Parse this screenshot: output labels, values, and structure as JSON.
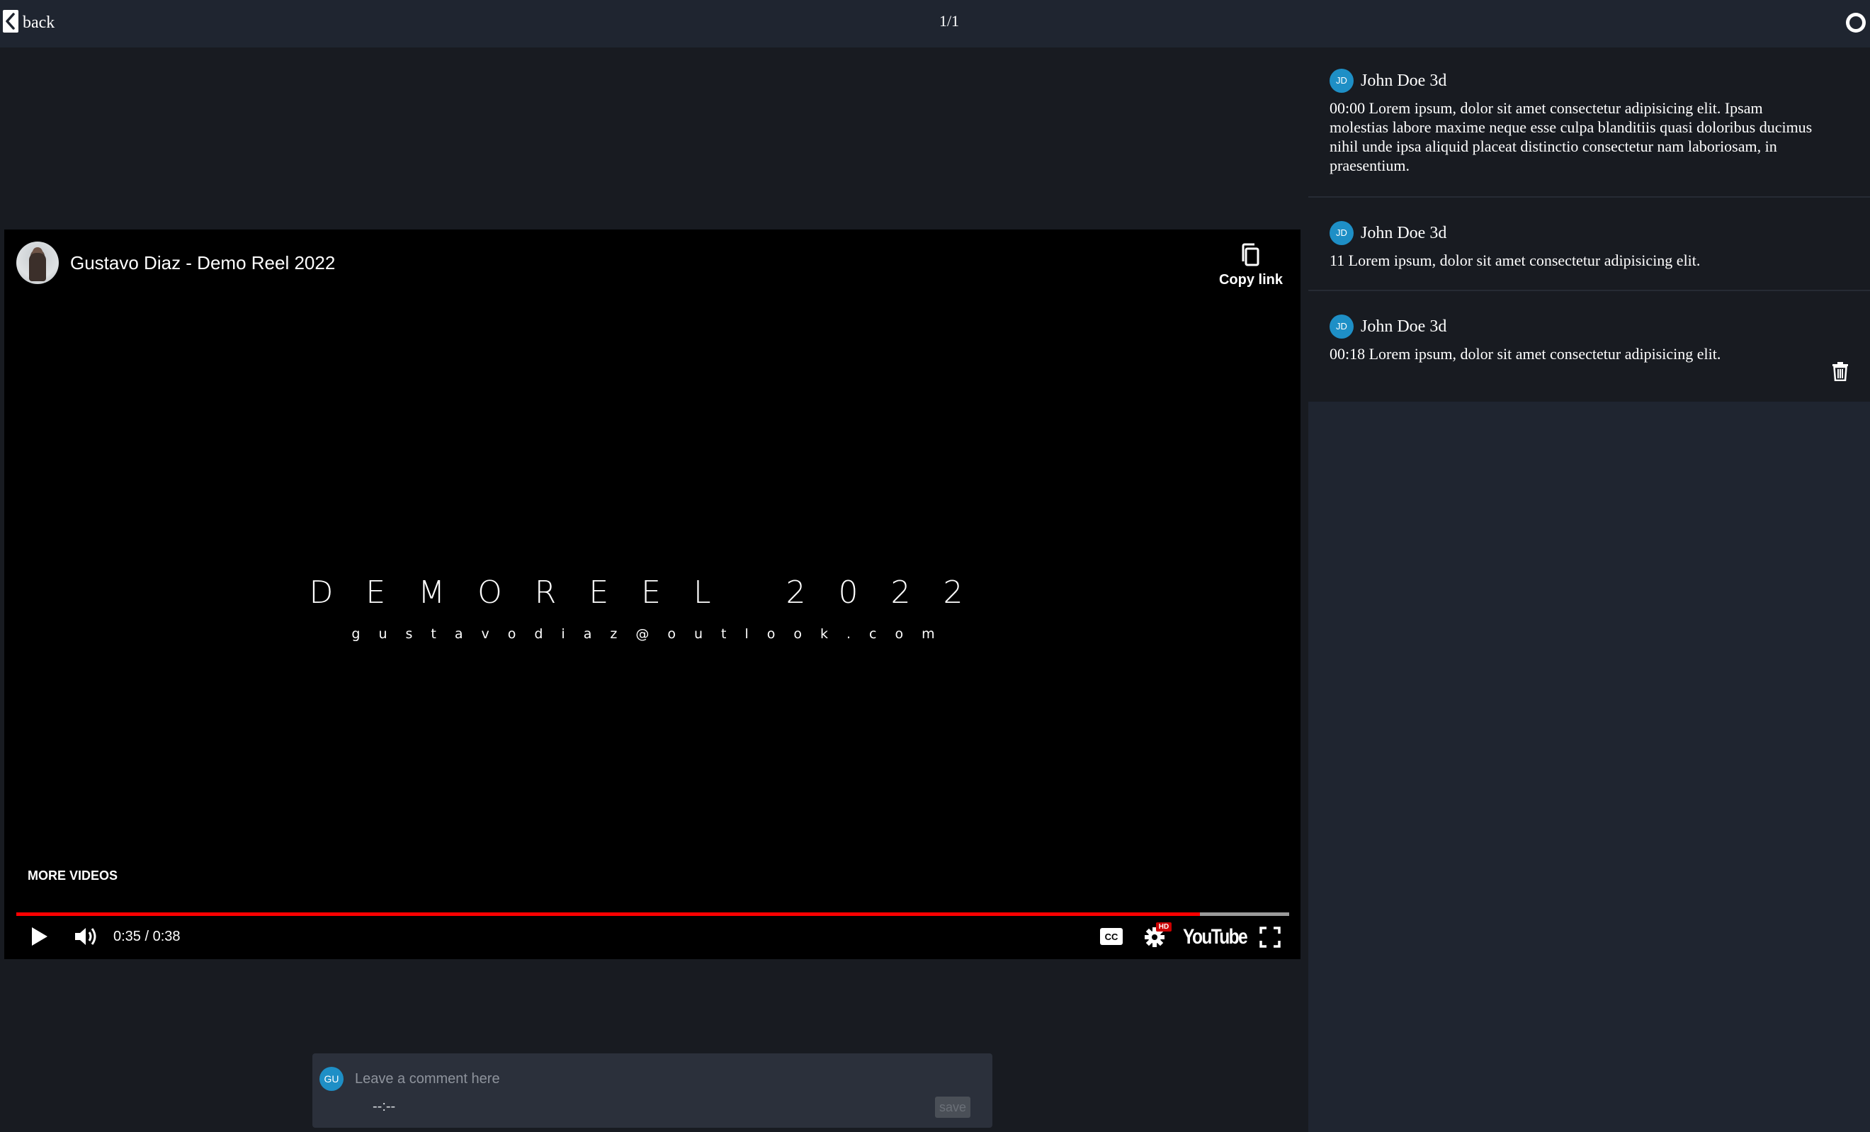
{
  "topbar": {
    "back_label": "back",
    "page_indicator": "1/1"
  },
  "player": {
    "channel_title": "Gustavo Diaz - Demo Reel 2022",
    "copy_link_label": "Copy link",
    "reel_title": "DEMOREEL 2022",
    "reel_subtitle": "gustavodiaz@outlook.com",
    "more_videos_label": "MORE VIDEOS",
    "time_display": "0:35 / 0:38",
    "progress_played_fraction": 0.93,
    "progress_buffered_fraction": 1.0,
    "hd_badge": "HD",
    "logo_text": "YouTube",
    "accent_color": "#ff0000"
  },
  "composer": {
    "avatar_initials": "GU",
    "placeholder": "Leave a comment here",
    "timestamp": "--:--",
    "save_label": "save"
  },
  "comments": [
    {
      "initials": "JD",
      "author": "John Doe 3d",
      "body": "00:00 Lorem ipsum, dolor sit amet consectetur adipisicing elit. Ipsam molestias labore maxime neque esse culpa blanditiis quasi doloribus ducimus nihil unde ipsa aliquid placeat distinctio consectetur nam laboriosam, in praesentium."
    },
    {
      "initials": "JD",
      "author": "John Doe 3d",
      "body": "11 Lorem ipsum, dolor sit amet consectetur adipisicing elit."
    },
    {
      "initials": "JD",
      "author": "John Doe 3d",
      "body": "00:18 Lorem ipsum, dolor sit amet consectetur adipisicing elit."
    }
  ],
  "icons": {
    "back": "chevron-left-icon",
    "status": "circle-icon",
    "copy": "copy-icon",
    "play": "play-icon",
    "volume": "volume-icon",
    "captions": "cc-icon",
    "settings": "gear-icon",
    "fullscreen": "fullscreen-icon",
    "delete": "trash-icon"
  }
}
